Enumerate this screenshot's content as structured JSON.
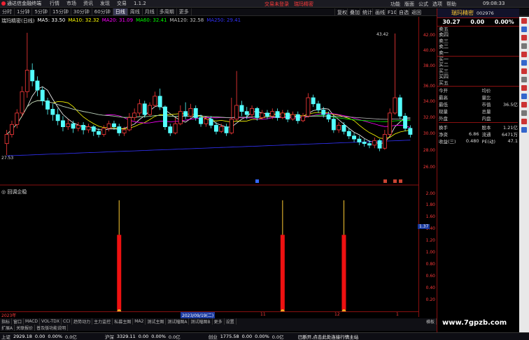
{
  "app": {
    "title": "通达信金融终端",
    "menus": [
      "行情",
      "市场",
      "资讯",
      "发现",
      "交易",
      "1.1.2"
    ],
    "center_items": [
      "交易未登录",
      "瑞玛精密"
    ],
    "right_items": [
      "功能",
      "版面",
      "公式",
      "选项",
      "帮助"
    ],
    "time": "09:08:33"
  },
  "period_tabs": [
    "分时",
    "1分钟",
    "5分钟",
    "15分钟",
    "30分钟",
    "60分钟",
    "日线",
    "周线",
    "月线",
    "多周期",
    "更多"
  ],
  "active_period": "日线",
  "tools": [
    "复权",
    "叠加",
    "统计",
    "画线",
    "F10",
    "自选",
    "返回"
  ],
  "chart": {
    "stock_label": "瑞玛精密(日线)",
    "ma_legend": [
      {
        "label": "MA5: 33.50",
        "color": "#ffffff"
      },
      {
        "label": "MA10: 32.32",
        "color": "#ffff00"
      },
      {
        "label": "MA20: 31.09",
        "color": "#ff00ff"
      },
      {
        "label": "MA60: 32.41",
        "color": "#00ff00"
      },
      {
        "label": "MA120: 32.58",
        "color": "#c0c0c0"
      },
      {
        "label": "MA250: 29.41",
        "color": "#3333ff"
      }
    ],
    "price_ticks": [
      "42.00",
      "40.00",
      "38.00",
      "36.00",
      "34.00",
      "32.00",
      "30.00",
      "28.00",
      "26.00"
    ],
    "high_label": "43.42",
    "low_label": "27.53",
    "sub_indicator": "回调企稳",
    "sub_ticks": [
      "2.00",
      "1.80",
      "1.60",
      "1.40",
      "1.20",
      "1.00",
      "0.80",
      "0.60",
      "0.40",
      "0.20"
    ],
    "sub_marker": "1.37",
    "x_labels": [
      "2023年",
      "2023/09/19(二)",
      "11",
      "12",
      "1"
    ]
  },
  "chart_data": {
    "type": "candlestick",
    "y_range": [
      25.5,
      44.5
    ],
    "candles": [
      {
        "o": 29.0,
        "c": 30.2,
        "h": 30.8,
        "l": 27.5
      },
      {
        "o": 30.2,
        "c": 31.5,
        "h": 32.0,
        "l": 29.8
      },
      {
        "o": 31.5,
        "c": 33.0,
        "h": 33.5,
        "l": 31.0
      },
      {
        "o": 33.0,
        "c": 35.8,
        "h": 36.5,
        "l": 32.5
      },
      {
        "o": 35.8,
        "c": 38.6,
        "h": 43.5,
        "l": 35.0
      },
      {
        "o": 38.6,
        "c": 37.2,
        "h": 39.5,
        "l": 36.5
      },
      {
        "o": 37.2,
        "c": 36.0,
        "h": 37.8,
        "l": 35.2
      },
      {
        "o": 36.0,
        "c": 34.6,
        "h": 36.4,
        "l": 34.0
      },
      {
        "o": 34.6,
        "c": 33.5,
        "h": 35.0,
        "l": 32.8
      },
      {
        "o": 33.5,
        "c": 32.8,
        "h": 34.2,
        "l": 32.0
      },
      {
        "o": 32.8,
        "c": 32.0,
        "h": 33.6,
        "l": 31.4
      },
      {
        "o": 32.0,
        "c": 31.2,
        "h": 32.6,
        "l": 30.6
      },
      {
        "o": 31.2,
        "c": 31.6,
        "h": 32.2,
        "l": 30.8
      },
      {
        "o": 31.6,
        "c": 31.0,
        "h": 32.0,
        "l": 30.4
      },
      {
        "o": 31.0,
        "c": 31.4,
        "h": 31.8,
        "l": 30.6
      },
      {
        "o": 31.4,
        "c": 30.8,
        "h": 31.8,
        "l": 30.2
      },
      {
        "o": 30.8,
        "c": 31.2,
        "h": 31.6,
        "l": 30.4
      },
      {
        "o": 31.2,
        "c": 30.6,
        "h": 31.4,
        "l": 30.0
      },
      {
        "o": 30.6,
        "c": 30.2,
        "h": 31.0,
        "l": 29.8
      },
      {
        "o": 30.2,
        "c": 31.0,
        "h": 31.4,
        "l": 29.9
      },
      {
        "o": 31.0,
        "c": 31.6,
        "h": 32.0,
        "l": 30.6
      },
      {
        "o": 31.6,
        "c": 31.2,
        "h": 32.0,
        "l": 30.8
      },
      {
        "o": 31.2,
        "c": 30.4,
        "h": 31.6,
        "l": 30.0
      },
      {
        "o": 30.4,
        "c": 30.8,
        "h": 31.2,
        "l": 30.0
      },
      {
        "o": 30.8,
        "c": 32.4,
        "h": 33.0,
        "l": 30.6
      },
      {
        "o": 32.4,
        "c": 33.0,
        "h": 33.6,
        "l": 32.0
      },
      {
        "o": 33.0,
        "c": 34.2,
        "h": 34.8,
        "l": 32.6
      },
      {
        "o": 34.2,
        "c": 32.8,
        "h": 34.6,
        "l": 32.4
      },
      {
        "o": 32.8,
        "c": 34.0,
        "h": 34.4,
        "l": 32.6
      },
      {
        "o": 34.0,
        "c": 35.2,
        "h": 35.8,
        "l": 33.8
      },
      {
        "o": 35.2,
        "c": 33.8,
        "h": 36.2,
        "l": 33.4
      },
      {
        "o": 33.8,
        "c": 31.2,
        "h": 34.0,
        "l": 30.8
      },
      {
        "o": 31.2,
        "c": 30.4,
        "h": 31.6,
        "l": 30.0
      },
      {
        "o": 30.4,
        "c": 31.6,
        "h": 32.4,
        "l": 30.2
      },
      {
        "o": 31.6,
        "c": 33.2,
        "h": 34.0,
        "l": 31.4
      },
      {
        "o": 33.2,
        "c": 32.6,
        "h": 34.4,
        "l": 32.2
      },
      {
        "o": 32.6,
        "c": 33.6,
        "h": 34.2,
        "l": 32.4
      },
      {
        "o": 33.6,
        "c": 32.4,
        "h": 34.0,
        "l": 32.0
      },
      {
        "o": 32.4,
        "c": 31.6,
        "h": 32.8,
        "l": 31.2
      },
      {
        "o": 31.6,
        "c": 32.2,
        "h": 32.6,
        "l": 31.2
      },
      {
        "o": 32.2,
        "c": 31.4,
        "h": 32.6,
        "l": 31.0
      },
      {
        "o": 31.4,
        "c": 30.6,
        "h": 31.8,
        "l": 30.2
      },
      {
        "o": 30.6,
        "c": 31.2,
        "h": 31.6,
        "l": 30.4
      },
      {
        "o": 31.2,
        "c": 30.4,
        "h": 31.6,
        "l": 30.0
      },
      {
        "o": 30.4,
        "c": 32.2,
        "h": 35.0,
        "l": 30.2
      },
      {
        "o": 32.2,
        "c": 34.0,
        "h": 38.5,
        "l": 32.0
      },
      {
        "o": 34.0,
        "c": 33.2,
        "h": 34.6,
        "l": 32.6
      },
      {
        "o": 33.2,
        "c": 32.8,
        "h": 33.8,
        "l": 32.2
      },
      {
        "o": 32.8,
        "c": 33.6,
        "h": 34.0,
        "l": 32.4
      },
      {
        "o": 33.6,
        "c": 32.4,
        "h": 33.8,
        "l": 32.0
      },
      {
        "o": 32.4,
        "c": 33.0,
        "h": 33.4,
        "l": 32.2
      },
      {
        "o": 33.0,
        "c": 32.6,
        "h": 33.4,
        "l": 32.2
      },
      {
        "o": 32.6,
        "c": 33.2,
        "h": 33.6,
        "l": 32.2
      },
      {
        "o": 33.2,
        "c": 32.4,
        "h": 33.6,
        "l": 32.0
      },
      {
        "o": 32.4,
        "c": 33.0,
        "h": 33.4,
        "l": 32.2
      },
      {
        "o": 33.0,
        "c": 32.2,
        "h": 33.4,
        "l": 31.8
      },
      {
        "o": 32.2,
        "c": 32.8,
        "h": 33.2,
        "l": 32.0
      },
      {
        "o": 32.8,
        "c": 32.0,
        "h": 33.2,
        "l": 31.6
      },
      {
        "o": 32.0,
        "c": 32.6,
        "h": 33.0,
        "l": 31.8
      },
      {
        "o": 32.6,
        "c": 35.0,
        "h": 35.6,
        "l": 32.4
      },
      {
        "o": 35.0,
        "c": 34.2,
        "h": 35.4,
        "l": 33.8
      },
      {
        "o": 34.2,
        "c": 33.4,
        "h": 34.6,
        "l": 33.0
      },
      {
        "o": 33.4,
        "c": 32.8,
        "h": 33.8,
        "l": 32.4
      },
      {
        "o": 32.8,
        "c": 32.2,
        "h": 33.2,
        "l": 31.8
      },
      {
        "o": 32.2,
        "c": 30.8,
        "h": 32.6,
        "l": 30.4
      },
      {
        "o": 30.8,
        "c": 31.4,
        "h": 31.8,
        "l": 30.4
      },
      {
        "o": 31.4,
        "c": 30.6,
        "h": 31.8,
        "l": 30.2
      },
      {
        "o": 30.6,
        "c": 30.0,
        "h": 31.0,
        "l": 29.6
      },
      {
        "o": 30.0,
        "c": 29.6,
        "h": 30.4,
        "l": 29.2
      },
      {
        "o": 29.6,
        "c": 29.2,
        "h": 30.0,
        "l": 28.8
      },
      {
        "o": 29.2,
        "c": 29.0,
        "h": 29.6,
        "l": 28.6
      },
      {
        "o": 29.0,
        "c": 28.8,
        "h": 29.4,
        "l": 28.4
      },
      {
        "o": 28.8,
        "c": 29.4,
        "h": 29.8,
        "l": 28.4
      },
      {
        "o": 29.4,
        "c": 28.4,
        "h": 29.6,
        "l": 28.0
      },
      {
        "o": 28.4,
        "c": 30.2,
        "h": 30.8,
        "l": 28.2
      },
      {
        "o": 30.2,
        "c": 33.0,
        "h": 33.6,
        "l": 30.0
      },
      {
        "o": 33.0,
        "c": 35.0,
        "h": 43.4,
        "l": 32.8
      },
      {
        "o": 35.0,
        "c": 32.6,
        "h": 35.4,
        "l": 32.2
      },
      {
        "o": 32.6,
        "c": 31.0,
        "h": 33.0,
        "l": 30.6
      },
      {
        "o": 31.0,
        "c": 30.2,
        "h": 31.4,
        "l": 29.8
      }
    ],
    "signals": [
      {
        "index": 22,
        "value": 1.37
      },
      {
        "index": 54,
        "value": 1.37
      },
      {
        "index": 66,
        "value": 1.37
      }
    ],
    "sub_range": [
      0,
      2.1
    ]
  },
  "right_panel": {
    "name": "瑞玛精密",
    "code": "002976",
    "price": "30.27",
    "change": "0.00",
    "pct": "0.00%",
    "asks": [
      "卖五",
      "卖四",
      "卖三",
      "卖二",
      "卖一"
    ],
    "bids": [
      "买一",
      "买二",
      "买三",
      "买四",
      "买五"
    ],
    "stats": [
      {
        "k": "今开",
        "v": "",
        "k2": "均价",
        "v2": ""
      },
      {
        "k": "最高",
        "v": "",
        "k2": "量比",
        "v2": ""
      },
      {
        "k": "最低",
        "v": "",
        "k2": "市值",
        "v2": "36.5亿"
      },
      {
        "k": "现量",
        "v": "",
        "k2": "总量",
        "v2": ""
      },
      {
        "k": "外盘",
        "v": "",
        "k2": "内盘",
        "v2": ""
      }
    ],
    "stats2": [
      {
        "k": "换手",
        "v": "",
        "k2": "股本",
        "v2": "1.21亿"
      },
      {
        "k": "净资",
        "v": "6.86",
        "k2": "流通",
        "v2": "6471万"
      },
      {
        "k": "收益(三)",
        "v": "0.480",
        "k2": "PE(动)",
        "v2": "47.1"
      }
    ]
  },
  "bottom_tabs": [
    "指标",
    "窗口",
    "MACD",
    "VOL-TDX",
    "CCI",
    "趋势动力",
    "主力监控",
    "私募主图",
    "MA2",
    "测试主图",
    "测试幅图A",
    "测试幅图B",
    "更多",
    "设置"
  ],
  "bottom_tabs2": [
    "扩展A",
    "关联报价",
    "普及版功能说明"
  ],
  "bottom_right_label": "横板",
  "statusbar": {
    "sh_label": "上证",
    "sh_value": "2929.18",
    "sh_change": "0.00",
    "sh_pct": "0.00%",
    "sh_amount": "0.0亿",
    "sz_label": "沪深",
    "sz_value": "3329.11",
    "sz_change": "0.00",
    "sz_pct": "0.00%",
    "sz_amount": "0.0亿",
    "cy_label": "创业",
    "cy_value": "1775.58",
    "cy_change": "0.00",
    "cy_pct": "0.00%",
    "cy_amount": "0.0亿",
    "message": "已断开,点击此处连接行情主站"
  },
  "watermark": "www.7gpzb.com",
  "colors": {
    "up": "#ff3b3b",
    "down": "#54ffff",
    "axis": "#8a1010"
  }
}
